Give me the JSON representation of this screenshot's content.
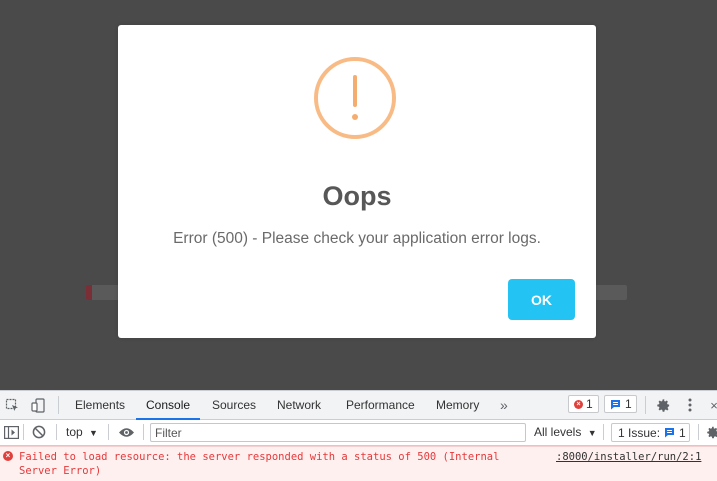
{
  "modal": {
    "title": "Oops",
    "message": "Error (500) - Please check your application error logs.",
    "ok_label": "OK",
    "icon": "warning-exclamation-icon",
    "icon_color": "#f8bb86",
    "button_color": "#23c3f4"
  },
  "devtools": {
    "tabs": [
      {
        "label": "Elements"
      },
      {
        "label": "Console"
      },
      {
        "label": "Sources"
      },
      {
        "label": "Network"
      },
      {
        "label": "Performance"
      },
      {
        "label": "Memory"
      }
    ],
    "active_tab": "Console",
    "more_tabs_glyph": "»",
    "error_count": "1",
    "message_count": "1",
    "toolbar": {
      "context": "top",
      "filter_placeholder": "Filter",
      "levels": "All levels",
      "issues_label": "1 Issue:",
      "issues_count": "1"
    },
    "console": {
      "messages": [
        {
          "level": "error",
          "text": "Failed to load resource: the server responded with a status of 500 (Internal\nServer Error)",
          "source": ":8000/installer/run/2:1"
        }
      ]
    }
  }
}
